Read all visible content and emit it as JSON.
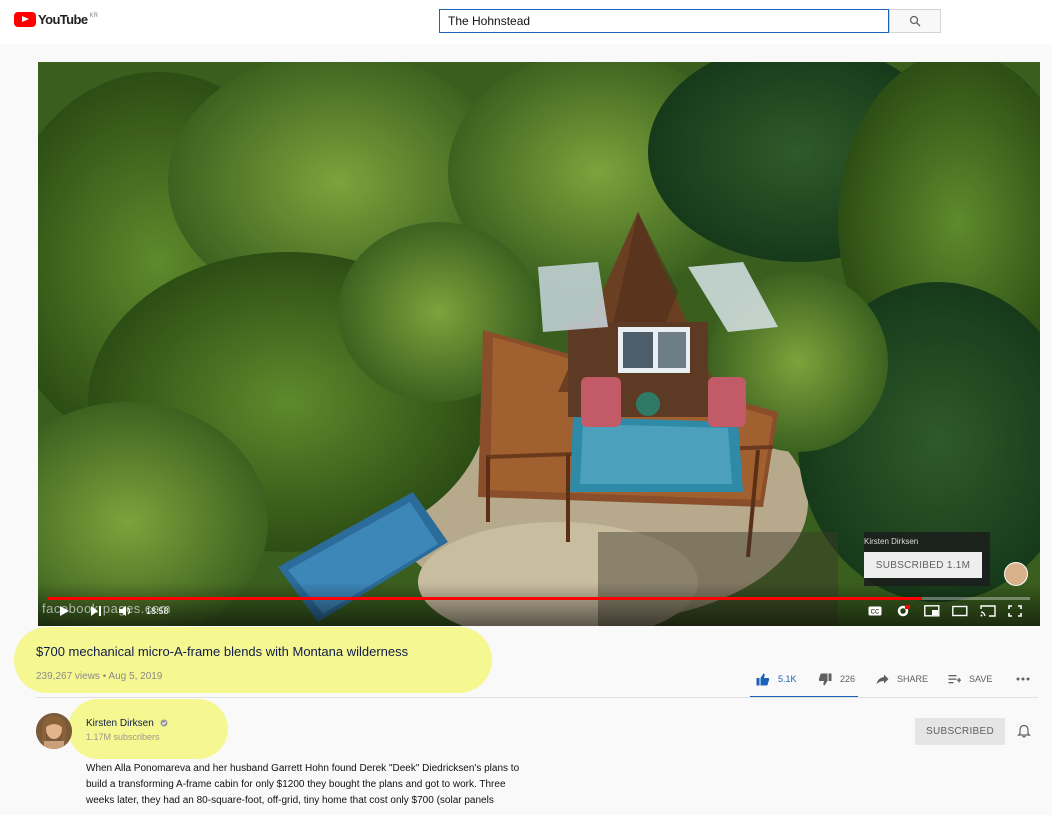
{
  "header": {
    "logo_text": "YouTube",
    "logo_country": "KR",
    "search_value": "The Hohnstead",
    "search_icon": "search-icon"
  },
  "player": {
    "notification_channel": "Kirsten Dirksen",
    "notification_button": "SUBSCRIBED 1.1M",
    "watermark": "facebook pages.com",
    "timecode": "18:58",
    "progress": 0.89,
    "icons": [
      "play-icon",
      "next-icon",
      "volume-icon",
      "cc-icon",
      "settings-icon",
      "miniplayer-icon",
      "theater-icon",
      "cast-icon",
      "fullscreen-icon"
    ]
  },
  "video": {
    "title": "$700 mechanical micro-A-frame blends with Montana wilderness",
    "meta": "239,267 views • Aug 5, 2019",
    "actions": {
      "likes": "5.1K",
      "dislikes": "226",
      "share": "SHARE",
      "save": "SAVE"
    }
  },
  "channel": {
    "name": "Kirsten Dirksen",
    "subscribers": "1.17M subscribers",
    "subscribe_button": "SUBSCRIBED"
  },
  "description": {
    "line1": "When Alla Ponomareva and her husband Garrett Hohn found Derek \"Deek\" Diedricksen's plans to",
    "line2": "build a transforming A-frame cabin for only $1200 they bought the plans and got to work. Three",
    "line3": "weeks later, they had an 80-square-foot, off-grid, tiny home that cost only $700 (solar panels"
  },
  "colors": {
    "brand_red": "#ff0000",
    "link_blue": "#1c62b9",
    "highlight": "#f4f77e"
  }
}
